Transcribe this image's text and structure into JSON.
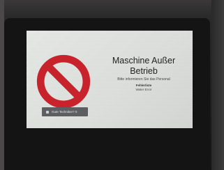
{
  "screen": {
    "title_line1": "Maschine Außer",
    "title_line2": "Betrieb",
    "subtitle": "Bitte informieren Sie das Personal",
    "label": "Fehlerliste",
    "value": "Water Error",
    "button_label": "Gute Techniker? 0",
    "icon": "stop-prohibited-icon"
  },
  "colors": {
    "sign_red": "#c8232c",
    "screen_bg": "#e2e4e2",
    "button_bg": "#5d5e62"
  }
}
